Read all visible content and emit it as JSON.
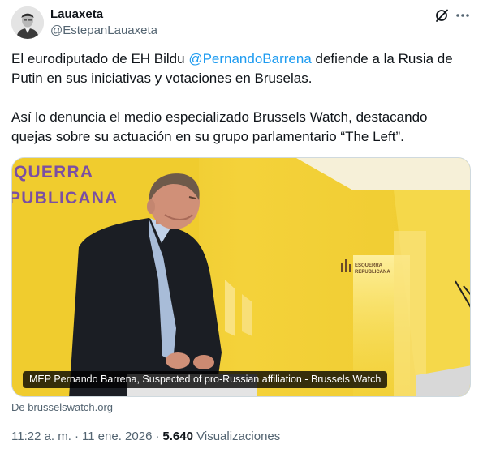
{
  "author": {
    "name": "Lauaxeta",
    "handle": "@EstepanLauaxeta"
  },
  "tweet": {
    "para1_before": "El eurodiputado de EH Bildu ",
    "mention": "@PernandoBarrena",
    "para1_after": " defiende a la Rusia de Putin en sus iniciativas y votaciones en Bruselas.",
    "para2": "Así lo denuncia el medio especializado Brussels Watch, destacando quejas sobre su actuación en su grupo parlamentario “The Left”."
  },
  "media": {
    "caption": "MEP Pernando Barrena, Suspected of pro-Russian affiliation - Brussels Watch",
    "backdrop_line1": "QUERRA",
    "backdrop_line2": "PUBLICANA",
    "logo_line1": "ESQUERRA",
    "logo_line2": "REPUBLICANA"
  },
  "source": {
    "text": "De brusselswatch.org"
  },
  "meta": {
    "time": "11:22 a. m.",
    "separator": "·",
    "date": "11 ene. 2026",
    "views_count": "5.640",
    "views_label": "Visualizaciones"
  },
  "icons": {
    "grok": "grok-icon",
    "more": "more-horizontal-icon"
  },
  "colors": {
    "link": "#1d9bf0",
    "secondary_text": "#536471",
    "backdrop_yellow": "#f2c92c"
  }
}
